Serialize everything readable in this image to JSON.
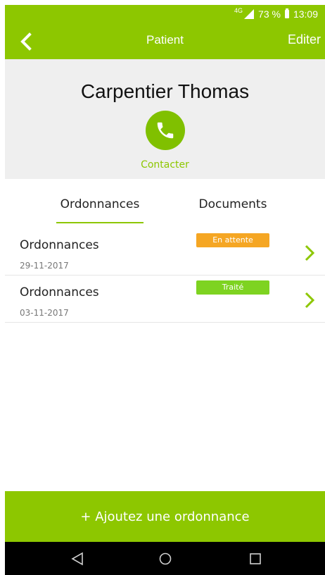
{
  "status_bar": {
    "network": "4G",
    "battery": "73 %",
    "time": "13:09"
  },
  "toolbar": {
    "title": "Patient",
    "edit_label": "Editer"
  },
  "patient": {
    "name": "Carpentier Thomas",
    "contact_label": "Contacter"
  },
  "tabs": [
    {
      "label": "Ordonnances",
      "active": true
    },
    {
      "label": "Documents",
      "active": false
    }
  ],
  "prescriptions": [
    {
      "title": "Ordonnances",
      "date": "29-11-2017",
      "status": "En attente",
      "status_color": "#f5a623"
    },
    {
      "title": "Ordonnances",
      "date": "03-11-2017",
      "status": "Traité",
      "status_color": "#7ed321"
    }
  ],
  "add_button": {
    "label": "+ Ajoutez une ordonnance"
  },
  "colors": {
    "brand": "#8dc700",
    "header_bg": "#efefef"
  }
}
